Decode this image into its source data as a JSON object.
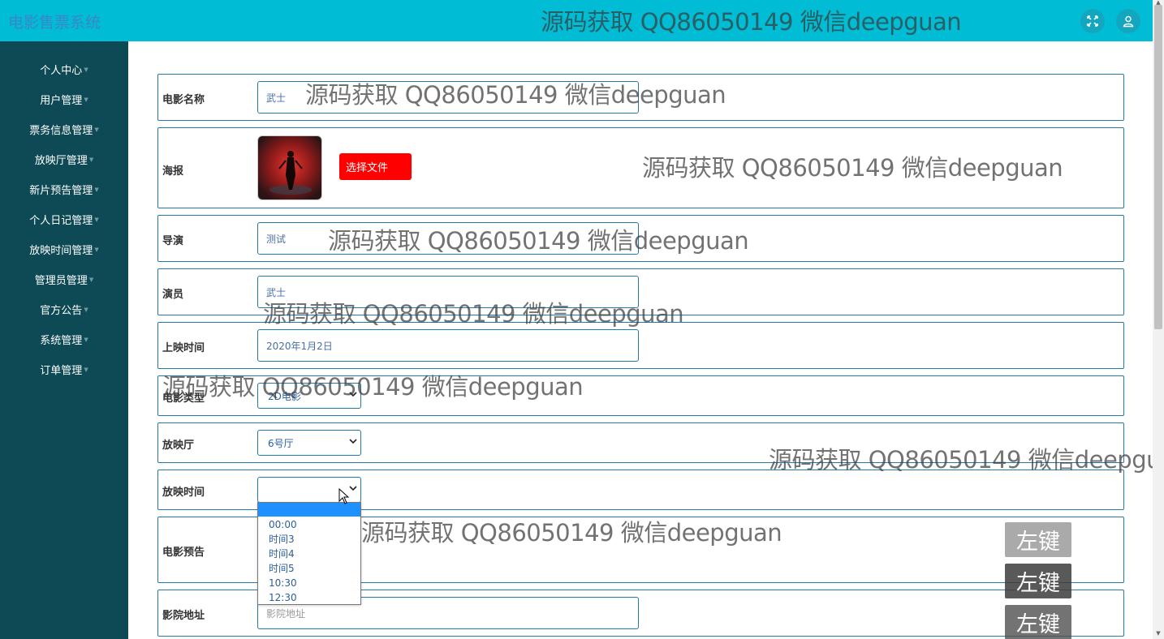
{
  "app": {
    "title": "电影售票系统"
  },
  "topbar": {
    "icons": [
      "fullscreen-icon",
      "user-icon"
    ]
  },
  "sidebar": {
    "items": [
      {
        "label": "个人中心"
      },
      {
        "label": "用户管理"
      },
      {
        "label": "票务信息管理"
      },
      {
        "label": "放映厅管理"
      },
      {
        "label": "新片预告管理"
      },
      {
        "label": "个人日记管理"
      },
      {
        "label": "放映时间管理"
      },
      {
        "label": "管理员管理"
      },
      {
        "label": "官方公告"
      },
      {
        "label": "系统管理"
      },
      {
        "label": "订单管理"
      }
    ]
  },
  "form": {
    "movie_name": {
      "label": "电影名称",
      "value": "武士"
    },
    "poster": {
      "label": "海报",
      "button": "选择文件"
    },
    "director": {
      "label": "导演",
      "value": "测试"
    },
    "actors": {
      "label": "演员",
      "value": "武士"
    },
    "release_date": {
      "label": "上映时间",
      "value": "2020年1月2日"
    },
    "movie_type": {
      "label": "电影类型",
      "value": "2D电影"
    },
    "hall": {
      "label": "放映厅",
      "value": "6号厅"
    },
    "showtime": {
      "label": "放映时间",
      "value": "",
      "options": [
        "",
        "00:00",
        "时间3",
        "时间4",
        "时间5",
        "10:30",
        "12:30"
      ]
    },
    "trailer": {
      "label": "电影预告"
    },
    "address": {
      "label": "影院地址",
      "placeholder": "影院地址"
    }
  },
  "watermark": "源码获取 QQ86050149 微信deepguan",
  "click_badges": [
    "左键",
    "左键",
    "左键"
  ],
  "colors": {
    "topbar": "#00bcd4",
    "sidebar": "#0e4a55",
    "border": "#2379a8",
    "button": "#ff0000",
    "dropdown_highlight": "#1e90ff"
  }
}
